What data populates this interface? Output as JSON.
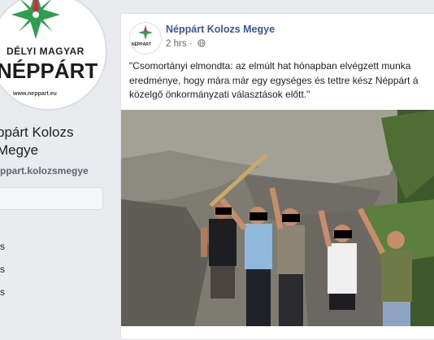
{
  "sidebar": {
    "logo_line1": "DÉLYI MAGYAR",
    "logo_line2": "NÉPPÁRT",
    "logo_url": "www.neppart.eu",
    "page_name": "ppárt Kolozs Megye",
    "page_handle": "ppart.kolozsmegye",
    "nav_items": [
      "s",
      "s",
      "s"
    ]
  },
  "post": {
    "author": "Néppárt Kolozs Megye",
    "time": "2 hrs",
    "separator": " · ",
    "privacy_icon": "globe-icon",
    "avatar_label": "NÉPPÁRT",
    "text": "\"Csomortányi elmondta: az elmúlt hat hónapban elvégzett munka eredménye, hogy mára már egy egységes és tettre kész Néppárt á közelgő önkormányzati választások előtt.\"",
    "photo_icon": "photo-image"
  },
  "colors": {
    "background": "#e9ebee",
    "link": "#385898",
    "logo_green": "#2e9e4f",
    "logo_red": "#d7263d"
  }
}
